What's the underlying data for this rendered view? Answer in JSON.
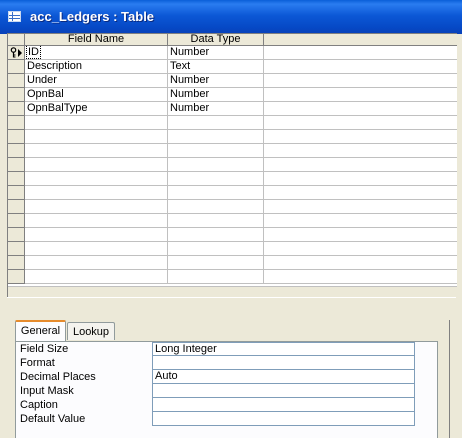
{
  "window": {
    "title": "acc_Ledgers : Table"
  },
  "grid": {
    "headers": {
      "field_name": "Field Name",
      "data_type": "Data Type",
      "description": ""
    },
    "rows": [
      {
        "field": "ID",
        "type": "Number",
        "primary_key": true,
        "current": true
      },
      {
        "field": "Description",
        "type": "Text"
      },
      {
        "field": "Under",
        "type": "Number"
      },
      {
        "field": "OpnBal",
        "type": "Number"
      },
      {
        "field": "OpnBalType",
        "type": "Number"
      },
      {
        "field": "",
        "type": ""
      },
      {
        "field": "",
        "type": ""
      },
      {
        "field": "",
        "type": ""
      },
      {
        "field": "",
        "type": ""
      },
      {
        "field": "",
        "type": ""
      },
      {
        "field": "",
        "type": ""
      },
      {
        "field": "",
        "type": ""
      },
      {
        "field": "",
        "type": ""
      },
      {
        "field": "",
        "type": ""
      },
      {
        "field": "",
        "type": ""
      },
      {
        "field": "",
        "type": ""
      },
      {
        "field": "",
        "type": ""
      }
    ]
  },
  "properties": {
    "tabs": {
      "general": "General",
      "lookup": "Lookup"
    },
    "active_tab": "General",
    "items": [
      {
        "label": "Field Size",
        "value": "Long Integer"
      },
      {
        "label": "Format",
        "value": ""
      },
      {
        "label": "Decimal Places",
        "value": "Auto"
      },
      {
        "label": "Input Mask",
        "value": ""
      },
      {
        "label": "Caption",
        "value": ""
      },
      {
        "label": "Default Value",
        "value": ""
      }
    ]
  },
  "icons": {
    "primary_key": "key-icon",
    "current_row": "row-pointer-icon",
    "table": "table-icon"
  },
  "colors": {
    "titlebar": "#0c58d6",
    "tab_accent": "#e68b2c",
    "chrome": "#ece9d8"
  }
}
